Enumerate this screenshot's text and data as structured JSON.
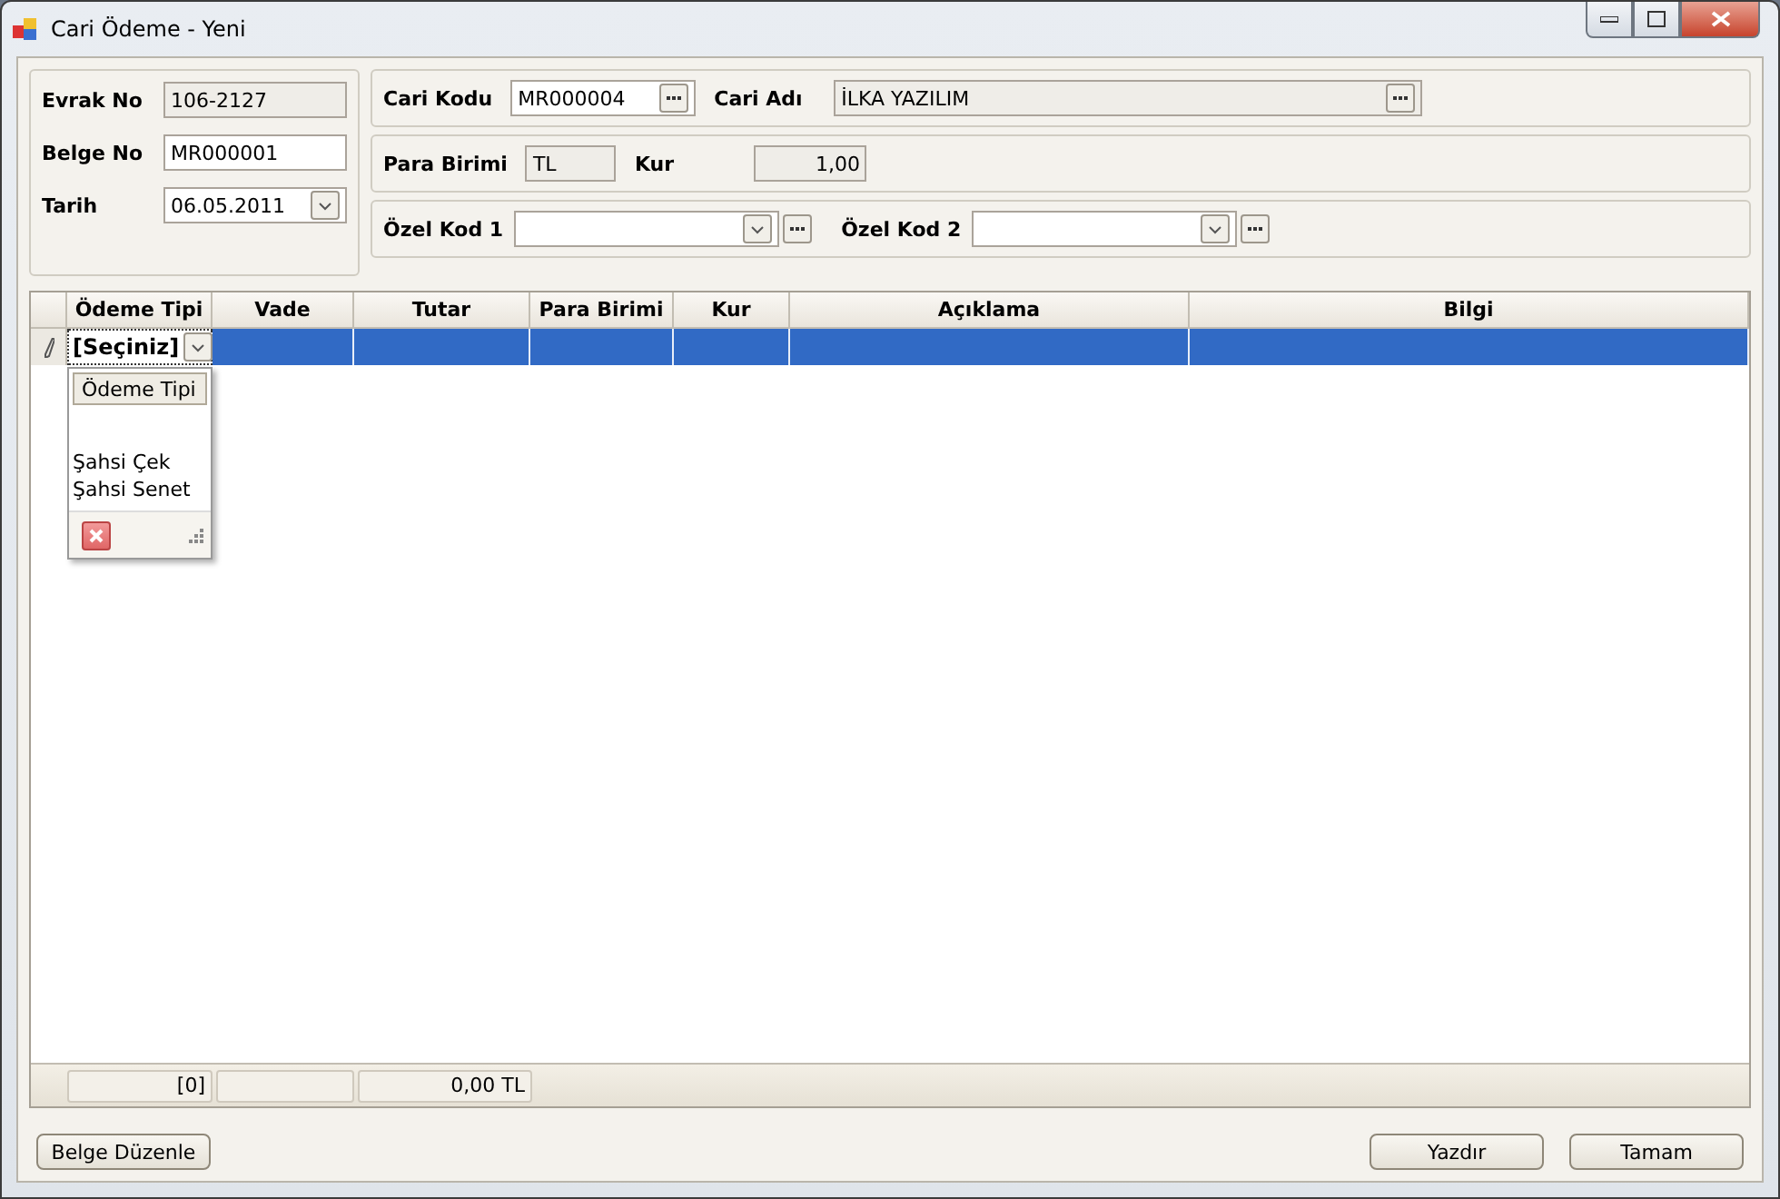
{
  "window": {
    "title": "Cari Ödeme - Yeni"
  },
  "header_fields": [
    {
      "label": "Evrak No",
      "value": "106-2127",
      "kind": "readonly"
    },
    {
      "label": "Belge No",
      "value": "MR000001",
      "kind": "text"
    },
    {
      "label": "Tarih",
      "value": "06.05.2011",
      "kind": "date"
    }
  ],
  "account": {
    "code_label": "Cari Kodu",
    "code": "MR000004",
    "name_label": "Cari Adı",
    "name": "İLKA YAZILIM"
  },
  "currency": {
    "label": "Para Birimi",
    "value": "TL",
    "rate_label": "Kur",
    "rate": "1,00"
  },
  "special_codes": [
    {
      "label": "Özel Kod 1"
    },
    {
      "label": "Özel Kod 2"
    }
  ],
  "grid": {
    "columns": [
      "Ödeme Tipi",
      "Vade",
      "Tutar",
      "Para Birimi",
      "Kur",
      "Açıklama",
      "Bilgi"
    ],
    "rows": [
      {
        "selected": true,
        "payment_type": "[Seçiniz]"
      }
    ],
    "footer": {
      "count": "[0]",
      "total": "0,00 TL"
    }
  },
  "dropdown": {
    "header": "Ödeme Tipi",
    "options": [
      "Şahsi Çek",
      "Şahsi Senet"
    ]
  },
  "buttons_left": [
    "Belge Düzenle"
  ],
  "buttons_right": [
    "Yazdır",
    "Tamam"
  ]
}
